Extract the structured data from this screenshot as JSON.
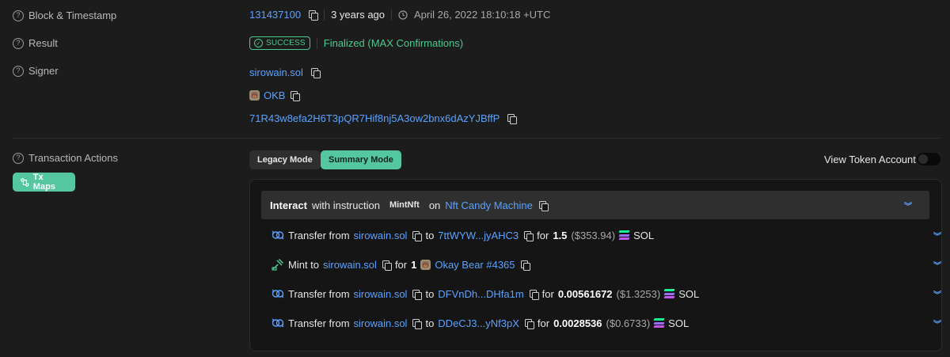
{
  "labels": {
    "block": "Block & Timestamp",
    "result": "Result",
    "signer": "Signer",
    "actions": "Transaction Actions"
  },
  "block": {
    "number": "131437100",
    "ago": "3 years ago",
    "timestamp": "April 26, 2022 18:10:18 +UTC"
  },
  "result": {
    "badge": "SUCCESS",
    "status": "Finalized (MAX Confirmations)"
  },
  "signer": {
    "primary": "sirowain.sol",
    "secondary": "OKB",
    "address": "71R43w8efa2H6T3pQR7Hif8nj5A3ow2bnx6dAzYJBffP"
  },
  "buttons": {
    "tx_maps": "Tx Maps",
    "legacy": "Legacy Mode",
    "summary": "Summary Mode",
    "view_token_account": "View Token Account"
  },
  "instruction": {
    "interact": "Interact",
    "with_instruction": "with instruction",
    "code": "MintNft",
    "on": "on",
    "program": "Nft Candy Machine"
  },
  "actions": [
    {
      "verb": "Transfer from",
      "from": "sirowain.sol",
      "to_word": "to",
      "to": "7ttWYW...jyAHC3",
      "for_word": "for",
      "amount": "1.5",
      "usd": "($353.94)",
      "token": "SOL"
    },
    {
      "verb": "Mint to",
      "from": "sirowain.sol",
      "for_word": "for",
      "amount": "1",
      "token": "Okay Bear #4365"
    },
    {
      "verb": "Transfer from",
      "from": "sirowain.sol",
      "to_word": "to",
      "to": "DFVnDh...DHfa1m",
      "for_word": "for",
      "amount": "0.00561672",
      "usd": "($1.3253)",
      "token": "SOL"
    },
    {
      "verb": "Transfer from",
      "from": "sirowain.sol",
      "to_word": "to",
      "to": "DDeCJ3...yNf3pX",
      "for_word": "for",
      "amount": "0.0028536",
      "usd": "($0.6733)",
      "token": "SOL"
    }
  ],
  "colors": {
    "accent": "#54c7a0",
    "link": "#5aa2ff",
    "success": "#4cc98f",
    "background": "#1c1c1c"
  },
  "icons": {
    "help": "question-circle-icon",
    "copy": "copy-icon",
    "clock": "clock-icon",
    "transfer": "transfer-icon",
    "mint": "mint-icon",
    "chevron": "chevron-double-down-icon"
  }
}
